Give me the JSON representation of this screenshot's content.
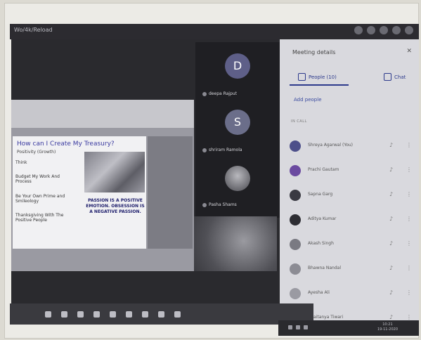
{
  "window": {
    "tab_title": "Wo/4k/Reload"
  },
  "slide": {
    "title": "How can I Create My Treasury?",
    "subtitle": "Positivity (Growth)",
    "bullets": [
      "Think",
      "Budget My Work And Process",
      "Be Your Own Prime and Smileology",
      "Thanksgiving With The Positive People"
    ],
    "quote": "PASSION IS A POSITIVE EMOTION. OBSESSION IS A NEGATIVE PASSION."
  },
  "tiles": [
    {
      "initial": "D",
      "name": "deepa Rajput"
    },
    {
      "initial": "S",
      "name": "shriram Ramola"
    },
    {
      "initial": "",
      "name": "Pasha Shams"
    }
  ],
  "panel": {
    "title": "Meeting details",
    "people_tab": "People (10)",
    "chat_tab": "Chat",
    "add_people": "Add people",
    "section_label": "IN CALL",
    "people": [
      {
        "name": "Shreya Agarwal (You)",
        "color": "#4d4f8a"
      },
      {
        "name": "Prachi Gautam",
        "color": "#6b4aa0"
      },
      {
        "name": "Sapna Garg",
        "color": "#3a3a42"
      },
      {
        "name": "Aditya Kumar",
        "color": "#2d2d33"
      },
      {
        "name": "Akash Singh",
        "color": "#7a7a82"
      },
      {
        "name": "Bhawna Nandal",
        "color": "#8c8c94"
      },
      {
        "name": "Ayesha Ali",
        "color": "#9a9aa2"
      },
      {
        "name": "Chaitanya Tiwari",
        "color": "#a0a0a8"
      }
    ]
  },
  "tray": {
    "time": "10:21",
    "date": "19-11-2020"
  }
}
